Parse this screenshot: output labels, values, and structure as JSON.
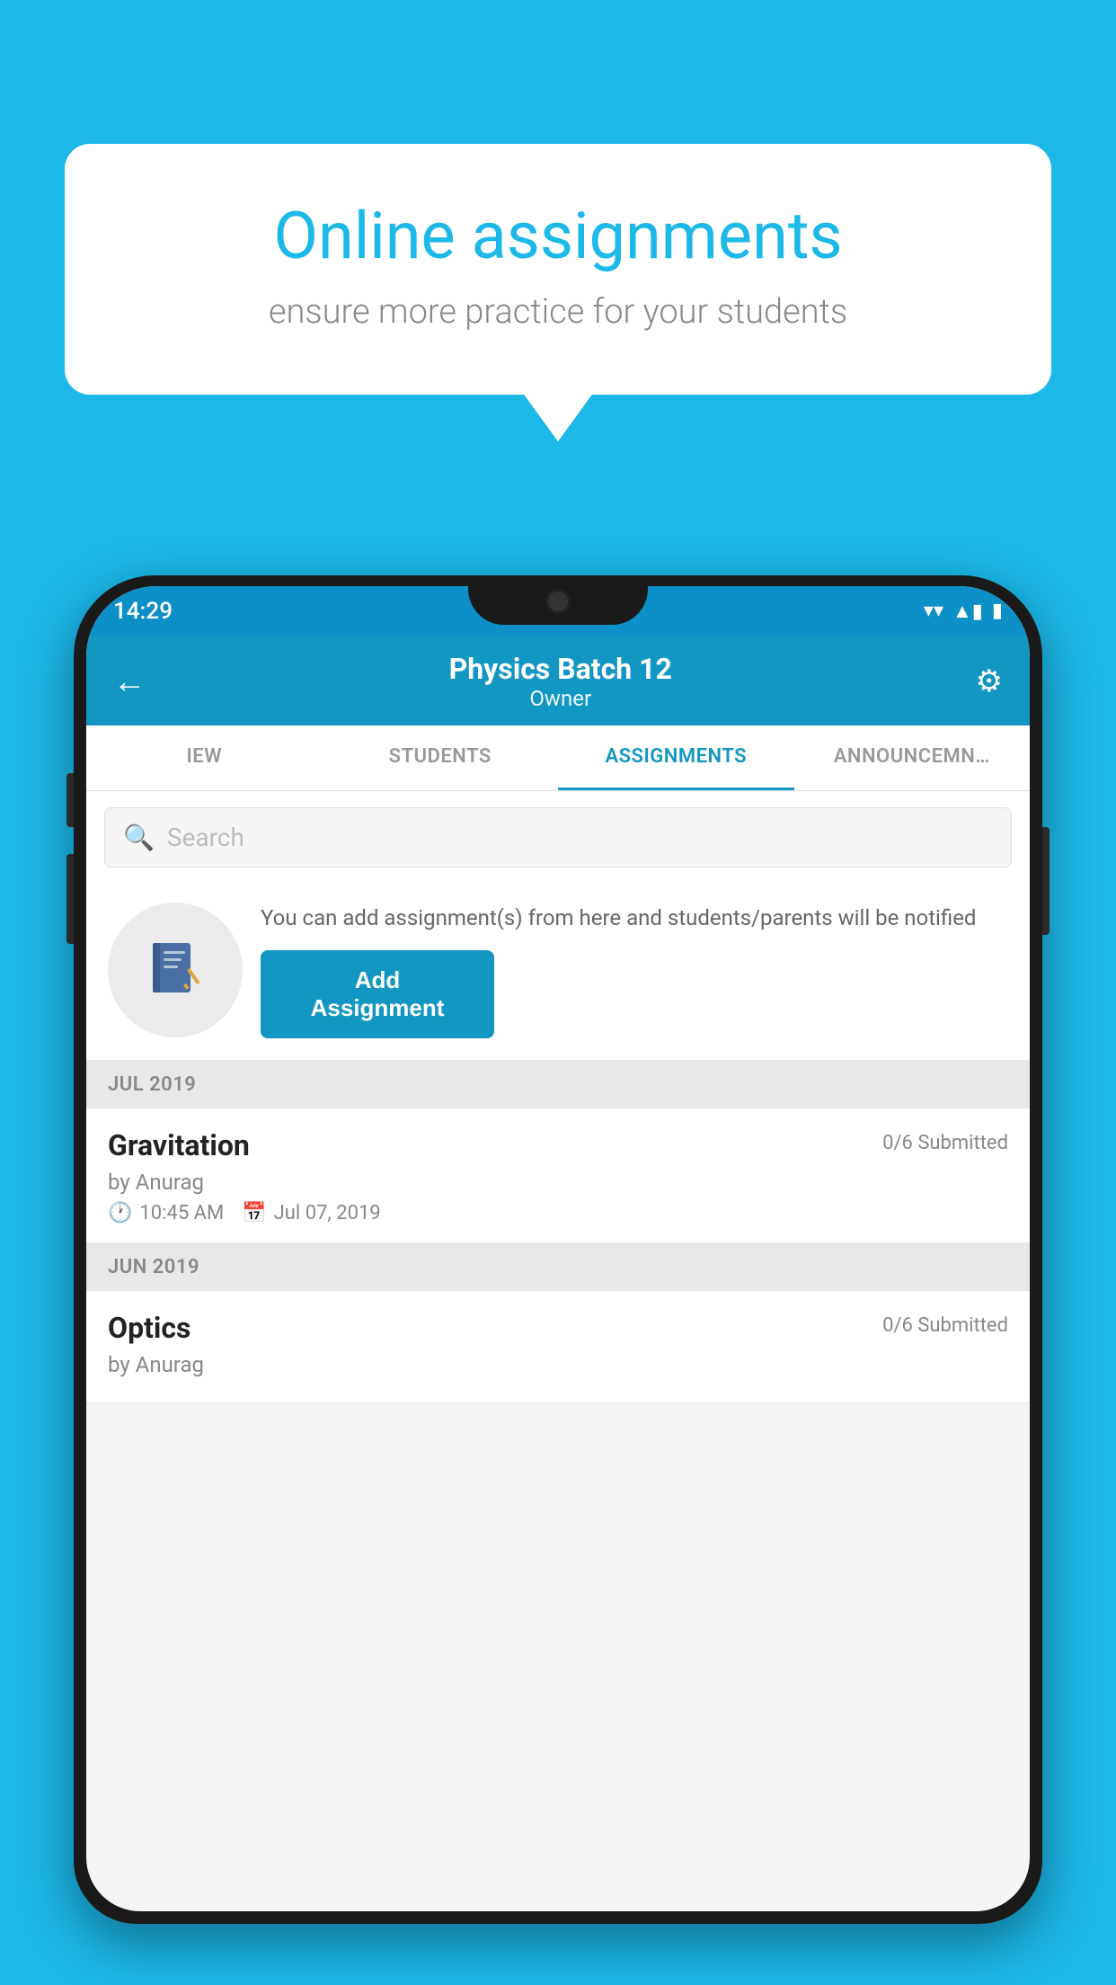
{
  "background_color": "#1bb8e8",
  "speech_bubble": {
    "title": "Online assignments",
    "subtitle": "ensure more practice for your students"
  },
  "status_bar": {
    "time": "14:29",
    "wifi": "▼",
    "signal": "▲",
    "battery": "▮"
  },
  "header": {
    "title": "Physics Batch 12",
    "subtitle": "Owner",
    "back_label": "←",
    "settings_label": "⚙"
  },
  "tabs": [
    {
      "label": "IEW",
      "active": false
    },
    {
      "label": "STUDENTS",
      "active": false
    },
    {
      "label": "ASSIGNMENTS",
      "active": true
    },
    {
      "label": "ANNOUNCEM…",
      "active": false
    }
  ],
  "search": {
    "placeholder": "Search"
  },
  "promo": {
    "description": "You can add assignment(s) from here and students/parents will be notified",
    "button_label": "Add Assignment"
  },
  "sections": [
    {
      "label": "JUL 2019",
      "assignments": [
        {
          "title": "Gravitation",
          "submitted": "0/6 Submitted",
          "author": "by Anurag",
          "time": "10:45 AM",
          "date": "Jul 07, 2019"
        }
      ]
    },
    {
      "label": "JUN 2019",
      "assignments": [
        {
          "title": "Optics",
          "submitted": "0/6 Submitted",
          "author": "by Anurag",
          "time": "",
          "date": ""
        }
      ]
    }
  ]
}
